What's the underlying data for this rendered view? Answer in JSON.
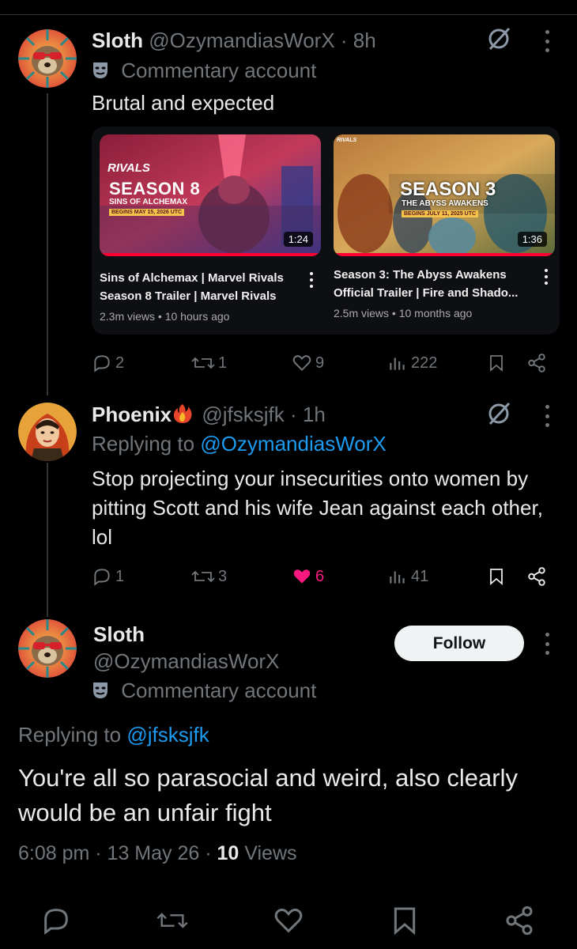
{
  "tweet1": {
    "name": "Sloth",
    "handle": "@OzymandiasWorX",
    "time": "· 8h",
    "badge": "Commentary account",
    "text": "Brutal and expected",
    "videos": [
      {
        "thumb_title": "SEASON 8",
        "thumb_subtitle": "SINS OF ALCHEMAX",
        "thumb_date": "BEGINS MAY 15, 2026 UTC",
        "thumb_brand": "RIVALS",
        "duration": "1:24",
        "title": "Sins of Alchemax | Marvel Rivals Season 8 Trailer | Marvel Rivals",
        "views": "2.3m views",
        "age": "10 hours ago"
      },
      {
        "thumb_title": "SEASON 3",
        "thumb_subtitle": "THE ABYSS AWAKENS",
        "thumb_date": "BEGINS JULY 11, 2025 UTC",
        "thumb_brand": "RIVALS",
        "duration": "1:36",
        "title": "Season 3: The Abyss Awakens Official Trailer | Fire and Shado...",
        "views": "2.5m views",
        "age": "10 months ago"
      }
    ],
    "replies": "2",
    "reposts": "1",
    "likes": "9",
    "views": "222"
  },
  "tweet2": {
    "name": "Phoenix",
    "handle": "@jfsksjfk",
    "time": "· 1h",
    "replying_prefix": "Replying to",
    "replying_to": "@OzymandiasWorX",
    "text": "Stop projecting your insecurities onto women by pitting Scott and his wife Jean against each other, lol",
    "replies": "1",
    "reposts": "3",
    "likes": "6",
    "views": "41",
    "like_color": "#f91880"
  },
  "tweet3": {
    "name": "Sloth",
    "handle": "@OzymandiasWorX",
    "badge": "Commentary account",
    "follow_label": "Follow",
    "replying_prefix": "Replying to",
    "replying_to": "@jfsksjfk",
    "text": "You're all so parasocial and weird, also clearly would be an unfair fight",
    "timestamp": "6:08 pm · 13 May 26 · ",
    "views_count": "10",
    "views_label": " Views"
  },
  "colors": {
    "link": "#1d9bf0",
    "muted": "#71767b",
    "like_active": "#f91880",
    "background": "#000000"
  },
  "icons": [
    "grok-icon",
    "more-icon",
    "reply-icon",
    "repost-icon",
    "like-icon",
    "views-icon",
    "bookmark-icon",
    "share-icon",
    "commentary-mask-icon",
    "fire-emoji-icon"
  ]
}
